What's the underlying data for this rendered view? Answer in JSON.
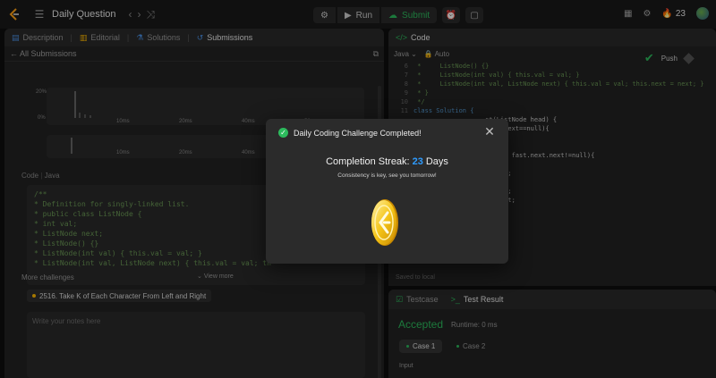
{
  "topbar": {
    "title": "Daily Question",
    "run_label": "Run",
    "submit_label": "Submit",
    "streak_count": "23"
  },
  "left": {
    "tabs": [
      "Description",
      "Editorial",
      "Solutions",
      "Submissions"
    ],
    "back_label": "All Submissions",
    "chart1_ticks": [
      "10ms",
      "20ms",
      "40ms",
      "56ms"
    ],
    "chart2_ticks": [
      "10ms",
      "20ms",
      "40ms"
    ],
    "y_ticks": [
      "20%",
      "0%"
    ],
    "code_label": "Code",
    "code_lang": "Java",
    "code_lines": [
      "/**",
      " * Definition for singly-linked list.",
      " * public class ListNode {",
      " *     int val;",
      " *     ListNode next;",
      " *     ListNode() {}",
      " *     ListNode(int val) { this.val = val; }",
      " *     ListNode(int val, ListNode next) { this.val = val; th"
    ],
    "view_more": "View more",
    "more_challenges": "More challenges",
    "challenge": "2516. Take K of Each Character From Left and Right",
    "notes_placeholder": "Write your notes here"
  },
  "editor": {
    "tab": "Code",
    "lang": "Java",
    "mode": "Auto",
    "push": "Push",
    "lines": [
      {
        "n": "6",
        "t": " *     ListNode() {}"
      },
      {
        "n": "7",
        "t": " *     ListNode(int val) { this.val = val; }"
      },
      {
        "n": "8",
        "t": " *     ListNode(int val, ListNode next) { this.val = val; this.next = next; }"
      },
      {
        "n": "9",
        "t": " * }"
      },
      {
        "n": "10",
        "t": " */"
      },
      {
        "n": "11",
        "t": "class Solution {"
      },
      {
        "n": "",
        "t": "                   st(ListNode head) {"
      },
      {
        "n": "",
        "t": "                   head.next==null){"
      },
      {
        "n": "",
        "t": ""
      },
      {
        "n": "",
        "t": ""
      },
      {
        "n": "",
        "t": "                   d;"
      },
      {
        "n": "",
        "t": "                   d;"
      },
      {
        "n": "",
        "t": "                   ull && fast.next.next!=null){"
      },
      {
        "n": "",
        "t": "                   ;"
      },
      {
        "n": "",
        "t": "                   t.next;"
      },
      {
        "n": "",
        "t": ""
      },
      {
        "n": "",
        "t": "                   ;"
      },
      {
        "n": "",
        "t": "                   w.next;"
      },
      {
        "n": "",
        "t": ""
      },
      {
        "n": "",
        "t": "                   mp.next;"
      },
      {
        "n": "",
        "t": "                   ;"
      }
    ],
    "saved": "Saved to local"
  },
  "result": {
    "tab1": "Testcase",
    "tab2": "Test Result",
    "status": "Accepted",
    "runtime": "Runtime: 0 ms",
    "case1": "Case 1",
    "case2": "Case 2",
    "input_label": "Input"
  },
  "modal": {
    "title": "Daily Coding Challenge Completed!",
    "streak_label": "Completion Streak:",
    "streak_value": "23",
    "streak_unit": "Days",
    "message": "Consistency is key, see you tomorrow!"
  },
  "colors": {
    "accent_green": "#2cbb5d",
    "streak_blue": "#2f9cff",
    "coin_gold": "#f5c518"
  }
}
